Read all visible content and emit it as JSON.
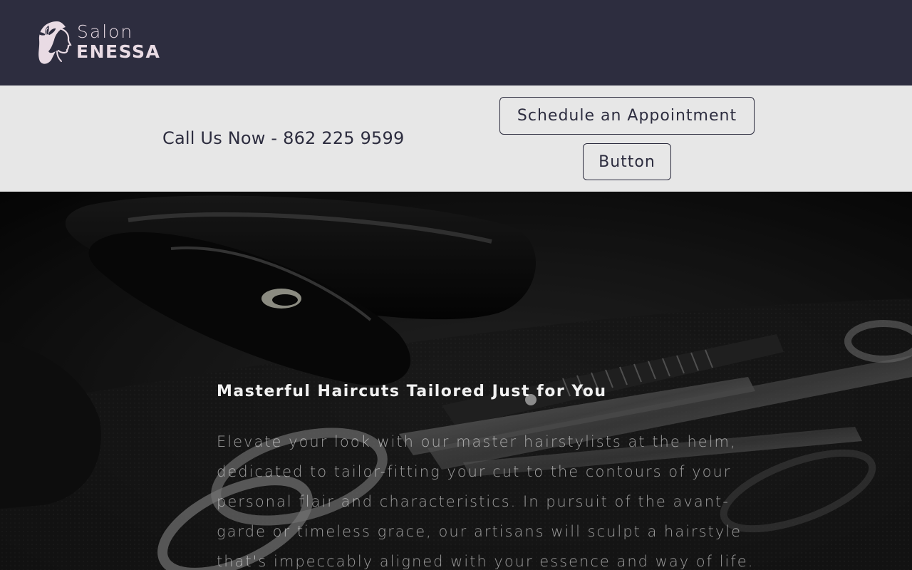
{
  "header": {
    "logo": {
      "icon": "woman-profile-lotus-icon",
      "line1": "Salon",
      "line2": "ENESSA"
    }
  },
  "cta_bar": {
    "phone_text": "Call Us Now - 862 225 9599",
    "appointment_button_label": "Schedule an Appointment",
    "generic_button_label": "Button"
  },
  "hero": {
    "title": "Masterful Haircuts Tailored Just for You",
    "body": "Elevate your look with our master hairstylists at the helm, dedicated to tailor-fitting your cut to the contours of your personal flair and characteristics. In pursuit of the avant-garde or timeless grace, our artisans will sculpt a hairstyle that's impeccably aligned with your essence and way of life.",
    "background_image": "black-and-white-barber-tools-scissors-thinning-shears-hair-dryer"
  },
  "colors": {
    "header_bg": "#2d2d3f",
    "cta_bg": "#e7e7e7",
    "brand_text": "#e9dbe4",
    "dark_text": "#2d2d3f"
  }
}
